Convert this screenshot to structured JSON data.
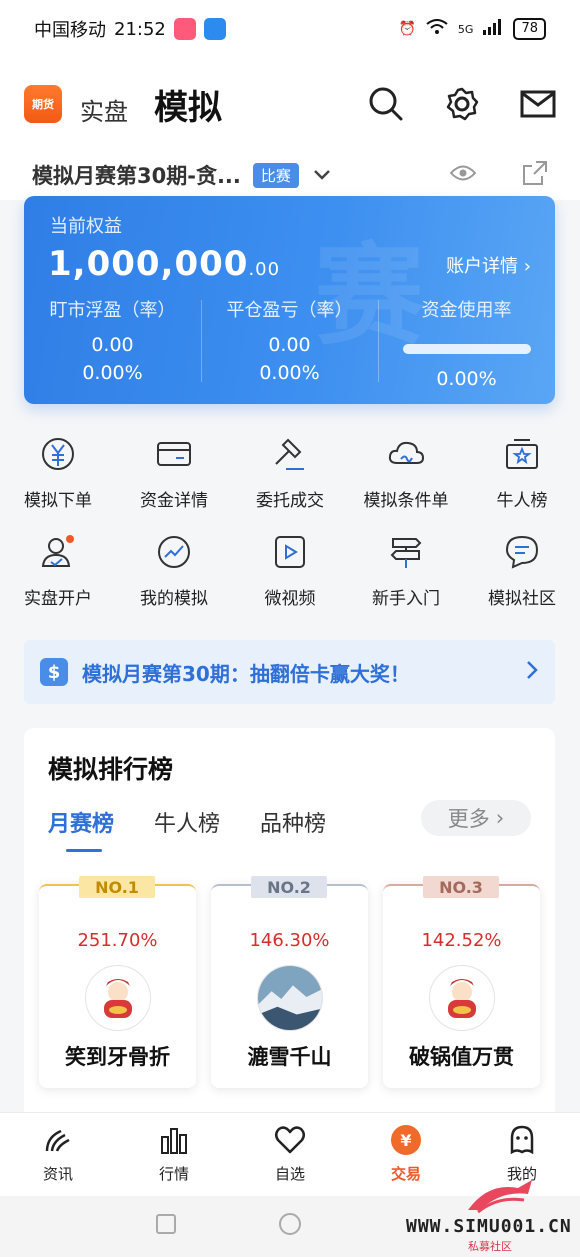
{
  "status_bar": {
    "carrier": "中国移动",
    "time": "21:52",
    "network": "5G",
    "battery": "78"
  },
  "top_nav": {
    "logo_text": "期货",
    "tab_real": "实盘",
    "tab_sim": "模拟"
  },
  "account": {
    "name": "模拟月赛第30期-贪...",
    "badge": "比赛"
  },
  "equity": {
    "label": "当前权益",
    "value_main": "1,000,000",
    "value_decimal": ".00",
    "detail_link": "账户详情",
    "watermark": "赛",
    "cols": [
      {
        "title": "盯市浮盈（率）",
        "v1": "0.00",
        "v2": "0.00%"
      },
      {
        "title": "平仓盈亏（率）",
        "v1": "0.00",
        "v2": "0.00%"
      },
      {
        "title": "资金使用率",
        "v2": "0.00%"
      }
    ]
  },
  "grid": [
    {
      "label": "模拟下单",
      "icon": "yuan-circle-icon"
    },
    {
      "label": "资金详情",
      "icon": "card-icon"
    },
    {
      "label": "委托成交",
      "icon": "gavel-icon"
    },
    {
      "label": "模拟条件单",
      "icon": "cloud-icon"
    },
    {
      "label": "牛人榜",
      "icon": "star-badge-icon"
    },
    {
      "label": "实盘开户",
      "icon": "user-add-icon"
    },
    {
      "label": "我的模拟",
      "icon": "trend-chart-icon"
    },
    {
      "label": "微视频",
      "icon": "play-icon"
    },
    {
      "label": "新手入门",
      "icon": "signpost-icon"
    },
    {
      "label": "模拟社区",
      "icon": "chat-icon"
    }
  ],
  "promo": {
    "icon_text": "$",
    "text": "模拟月赛第30期：抽翻倍卡赢大奖！"
  },
  "ranking": {
    "title": "模拟排行榜",
    "tabs": [
      "月赛榜",
      "牛人榜",
      "品种榜"
    ],
    "more": "更多",
    "entries": [
      {
        "rank": "NO.1",
        "pct": "251.70%",
        "name": "笑到牙骨折"
      },
      {
        "rank": "NO.2",
        "pct": "146.30%",
        "name": "漉雪千山"
      },
      {
        "rank": "NO.3",
        "pct": "142.52%",
        "name": "破锅值万贯"
      }
    ]
  },
  "tabbar": [
    {
      "label": "资讯",
      "icon": "news-icon"
    },
    {
      "label": "行情",
      "icon": "bar-chart-icon"
    },
    {
      "label": "自选",
      "icon": "heart-icon"
    },
    {
      "label": "交易",
      "icon": "trade-icon",
      "glyph": "¥"
    },
    {
      "label": "我的",
      "icon": "profile-icon"
    }
  ],
  "watermark": {
    "url": "WWW.SIMU001.CN",
    "sub": "私募社区"
  },
  "colors": {
    "accent": "#2e6fd8",
    "trade_orange": "#f06a2a",
    "profit_red": "#d62d2d"
  }
}
